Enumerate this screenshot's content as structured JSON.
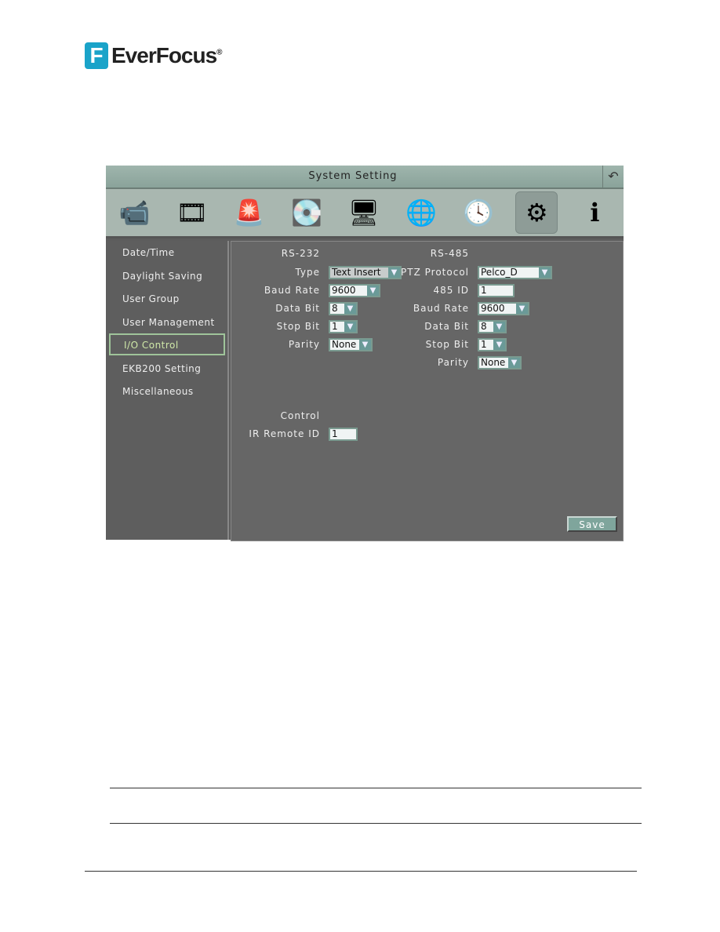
{
  "logo": {
    "text": "EverFocus",
    "mark": "F",
    "registered": "®"
  },
  "window": {
    "title": "System Setting",
    "back_icon": "return-arrow-icon"
  },
  "toolbar": {
    "icons": [
      "camera-icon",
      "record-reel-icon",
      "alarm-light-icon",
      "hard-disk-icon",
      "monitor-icon",
      "network-globe-icon",
      "clock-calendar-icon",
      "gear-icon",
      "info-icon"
    ],
    "selected": "gear-icon"
  },
  "sidebar": {
    "items": [
      {
        "label": "Date/Time"
      },
      {
        "label": "Daylight Saving"
      },
      {
        "label": "User Group"
      },
      {
        "label": "User Management"
      },
      {
        "label": "I/O Control",
        "selected": true
      },
      {
        "label": "EKB200 Setting"
      },
      {
        "label": "Miscellaneous"
      }
    ]
  },
  "rs232": {
    "heading": "RS-232",
    "type_label": "Type",
    "type_value": "Text Insert",
    "baud_label": "Baud Rate",
    "baud_value": "9600",
    "data_label": "Data Bit",
    "data_value": "8",
    "stop_label": "Stop Bit",
    "stop_value": "1",
    "parity_label": "Parity",
    "parity_value": "None"
  },
  "rs485": {
    "heading": "RS-485",
    "ptz_label": "PTZ Protocol",
    "ptz_value": "Pelco_D",
    "id_label": "485 ID",
    "id_value": "1",
    "baud_label": "Baud Rate",
    "baud_value": "9600",
    "data_label": "Data Bit",
    "data_value": "8",
    "stop_label": "Stop Bit",
    "stop_value": "1",
    "parity_label": "Parity",
    "parity_value": "None"
  },
  "control": {
    "heading": "Control",
    "ir_label": "IR Remote ID",
    "ir_value": "1"
  },
  "save_label": "Save"
}
